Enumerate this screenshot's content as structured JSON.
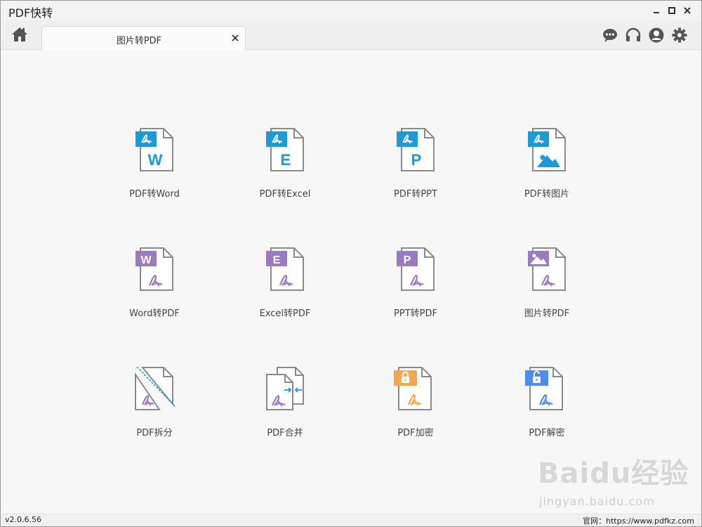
{
  "window": {
    "title": "PDF快转"
  },
  "tabs": [
    {
      "label": "图片转PDF"
    }
  ],
  "toolbar": {
    "icons": [
      "home-icon",
      "chat-icon",
      "headset-icon",
      "user-icon",
      "gear-icon"
    ]
  },
  "tools": {
    "pdf_to_word": {
      "label": "PDF转Word",
      "letter": "W"
    },
    "pdf_to_excel": {
      "label": "PDF转Excel",
      "letter": "E"
    },
    "pdf_to_ppt": {
      "label": "PDF转PPT",
      "letter": "P"
    },
    "pdf_to_image": {
      "label": "PDF转图片"
    },
    "word_to_pdf": {
      "label": "Word转PDF",
      "letter": "W"
    },
    "excel_to_pdf": {
      "label": "Excel转PDF",
      "letter": "E"
    },
    "ppt_to_pdf": {
      "label": "PPT转PDF",
      "letter": "P"
    },
    "image_to_pdf": {
      "label": "图片转PDF"
    },
    "pdf_split": {
      "label": "PDF拆分"
    },
    "pdf_merge": {
      "label": "PDF合并"
    },
    "pdf_encrypt": {
      "label": "PDF加密"
    },
    "pdf_decrypt": {
      "label": "PDF解密"
    }
  },
  "statusbar": {
    "version": "v2.0.6.56",
    "website": "官网：https://www.pdfkz.com"
  },
  "watermark": {
    "brand": "Baidu经验",
    "url": "jingyan.baidu.com"
  },
  "colors": {
    "blue": "#1a9ad8",
    "purple": "#9b7bc0",
    "orange": "#f5a84a",
    "lock_blue": "#4b8df2",
    "page_stroke": "#8a8a8a"
  }
}
